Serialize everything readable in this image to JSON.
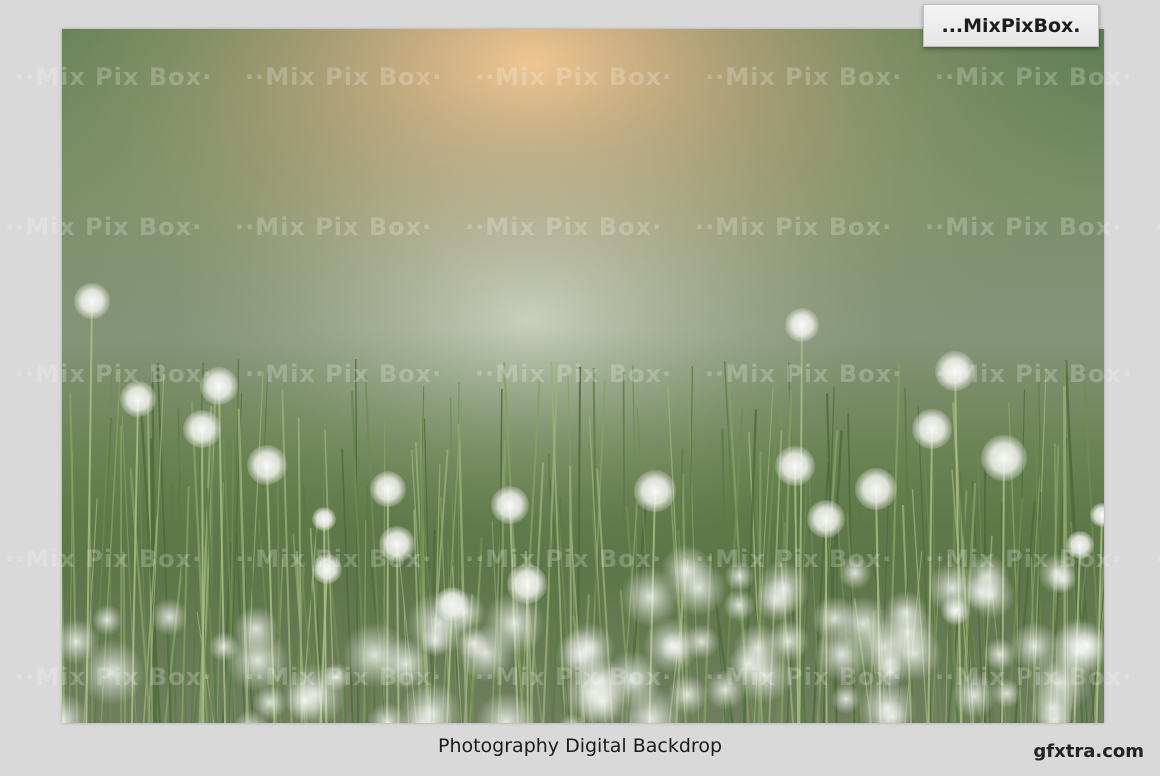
{
  "brand_badge": "...MixPixBox.",
  "watermark_text": "Mix Pix Box",
  "caption": "Photography Digital Backdrop",
  "site_watermark": "gfxtra.com",
  "colors": {
    "page_background": "#d9d9d9",
    "badge_background": "#efefef",
    "grass_dark": "#4f6b3c",
    "glow": "#f3c59a",
    "dandelion": "#f2f2ee"
  }
}
